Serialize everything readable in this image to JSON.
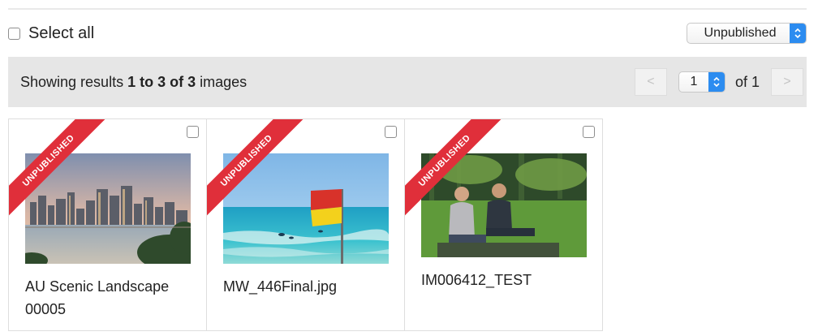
{
  "toolbar": {
    "select_all_label": "Select all",
    "status_filter": {
      "selected": "Unpublished"
    }
  },
  "results": {
    "prefix": "Showing results ",
    "range": "1 to 3 of 3",
    "suffix": " images"
  },
  "pagination": {
    "current_page": "1",
    "of_label": "of 1",
    "prev_label": "<",
    "next_label": ">"
  },
  "images": [
    {
      "title": "AU Scenic Landscape 00005",
      "status": "UNPUBLISHED",
      "thumbnail": "city-skyline-photo"
    },
    {
      "title": "MW_446Final.jpg",
      "status": "UNPUBLISHED",
      "thumbnail": "beach-flag-photo"
    },
    {
      "title": "IM006412_TEST",
      "status": "UNPUBLISHED",
      "thumbnail": "couple-on-grass-photo"
    }
  ],
  "colors": {
    "ribbon": "#e02f3a",
    "select_accent": "#2c8cf0",
    "results_bar": "#e6e6e6"
  }
}
